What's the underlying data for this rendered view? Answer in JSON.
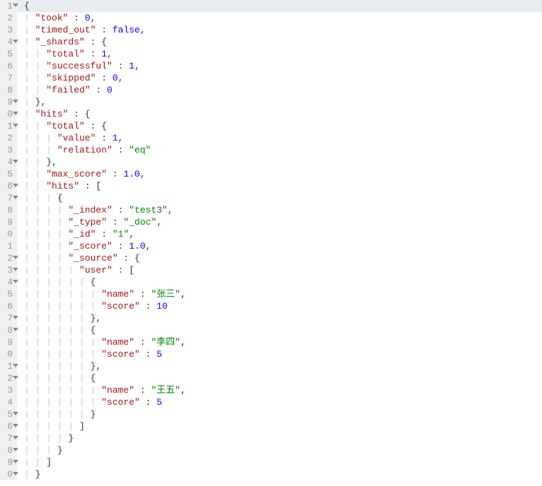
{
  "lines": [
    {
      "num": "1",
      "fold": true,
      "hl": true,
      "indent": 0,
      "text": [
        {
          "t": "pun",
          "v": "{"
        }
      ]
    },
    {
      "num": "2",
      "fold": false,
      "hl": false,
      "indent": 1,
      "text": [
        {
          "t": "key",
          "v": "\"took\""
        },
        {
          "t": "pun",
          "v": " : "
        },
        {
          "t": "num",
          "v": "0"
        },
        {
          "t": "pun",
          "v": ","
        }
      ]
    },
    {
      "num": "3",
      "fold": false,
      "hl": false,
      "indent": 1,
      "text": [
        {
          "t": "key",
          "v": "\"timed_out\""
        },
        {
          "t": "pun",
          "v": " : "
        },
        {
          "t": "kw",
          "v": "false"
        },
        {
          "t": "pun",
          "v": ","
        }
      ]
    },
    {
      "num": "4",
      "fold": true,
      "hl": false,
      "indent": 1,
      "text": [
        {
          "t": "key",
          "v": "\"_shards\""
        },
        {
          "t": "pun",
          "v": " : {"
        }
      ]
    },
    {
      "num": "5",
      "fold": false,
      "hl": false,
      "indent": 2,
      "text": [
        {
          "t": "key",
          "v": "\"total\""
        },
        {
          "t": "pun",
          "v": " : "
        },
        {
          "t": "num",
          "v": "1"
        },
        {
          "t": "pun",
          "v": ","
        }
      ]
    },
    {
      "num": "6",
      "fold": false,
      "hl": false,
      "indent": 2,
      "text": [
        {
          "t": "key",
          "v": "\"successful\""
        },
        {
          "t": "pun",
          "v": " : "
        },
        {
          "t": "num",
          "v": "1"
        },
        {
          "t": "pun",
          "v": ","
        }
      ]
    },
    {
      "num": "7",
      "fold": false,
      "hl": false,
      "indent": 2,
      "text": [
        {
          "t": "key",
          "v": "\"skipped\""
        },
        {
          "t": "pun",
          "v": " : "
        },
        {
          "t": "num",
          "v": "0"
        },
        {
          "t": "pun",
          "v": ","
        }
      ]
    },
    {
      "num": "8",
      "fold": false,
      "hl": false,
      "indent": 2,
      "text": [
        {
          "t": "key",
          "v": "\"failed\""
        },
        {
          "t": "pun",
          "v": " : "
        },
        {
          "t": "num",
          "v": "0"
        }
      ]
    },
    {
      "num": "9",
      "fold": true,
      "hl": false,
      "indent": 1,
      "text": [
        {
          "t": "pun",
          "v": "},"
        }
      ]
    },
    {
      "num": "0",
      "fold": true,
      "hl": false,
      "indent": 1,
      "text": [
        {
          "t": "key",
          "v": "\"hits\""
        },
        {
          "t": "pun",
          "v": " : {"
        }
      ]
    },
    {
      "num": "1",
      "fold": true,
      "hl": false,
      "indent": 2,
      "text": [
        {
          "t": "key",
          "v": "\"total\""
        },
        {
          "t": "pun",
          "v": " : {"
        }
      ]
    },
    {
      "num": "2",
      "fold": false,
      "hl": false,
      "indent": 3,
      "text": [
        {
          "t": "key",
          "v": "\"value\""
        },
        {
          "t": "pun",
          "v": " : "
        },
        {
          "t": "num",
          "v": "1"
        },
        {
          "t": "pun",
          "v": ","
        }
      ]
    },
    {
      "num": "3",
      "fold": false,
      "hl": false,
      "indent": 3,
      "text": [
        {
          "t": "key",
          "v": "\"relation\""
        },
        {
          "t": "pun",
          "v": " : "
        },
        {
          "t": "str",
          "v": "\"eq\""
        }
      ]
    },
    {
      "num": "4",
      "fold": true,
      "hl": false,
      "indent": 2,
      "text": [
        {
          "t": "pun",
          "v": "},"
        }
      ]
    },
    {
      "num": "5",
      "fold": false,
      "hl": false,
      "indent": 2,
      "text": [
        {
          "t": "key",
          "v": "\"max_score\""
        },
        {
          "t": "pun",
          "v": " : "
        },
        {
          "t": "num",
          "v": "1.0"
        },
        {
          "t": "pun",
          "v": ","
        }
      ]
    },
    {
      "num": "6",
      "fold": true,
      "hl": false,
      "indent": 2,
      "text": [
        {
          "t": "key",
          "v": "\"hits\""
        },
        {
          "t": "pun",
          "v": " : ["
        }
      ]
    },
    {
      "num": "7",
      "fold": true,
      "hl": false,
      "indent": 3,
      "text": [
        {
          "t": "pun",
          "v": "{"
        }
      ]
    },
    {
      "num": "8",
      "fold": false,
      "hl": false,
      "indent": 4,
      "text": [
        {
          "t": "key",
          "v": "\"_index\""
        },
        {
          "t": "pun",
          "v": " : "
        },
        {
          "t": "str",
          "v": "\"test3\""
        },
        {
          "t": "pun",
          "v": ","
        }
      ]
    },
    {
      "num": "9",
      "fold": false,
      "hl": false,
      "indent": 4,
      "text": [
        {
          "t": "key",
          "v": "\"_type\""
        },
        {
          "t": "pun",
          "v": " : "
        },
        {
          "t": "str",
          "v": "\"_doc\""
        },
        {
          "t": "pun",
          "v": ","
        }
      ]
    },
    {
      "num": "0",
      "fold": false,
      "hl": false,
      "indent": 4,
      "text": [
        {
          "t": "key",
          "v": "\"_id\""
        },
        {
          "t": "pun",
          "v": " : "
        },
        {
          "t": "str",
          "v": "\"1\""
        },
        {
          "t": "pun",
          "v": ","
        }
      ]
    },
    {
      "num": "1",
      "fold": false,
      "hl": false,
      "indent": 4,
      "text": [
        {
          "t": "key",
          "v": "\"_score\""
        },
        {
          "t": "pun",
          "v": " : "
        },
        {
          "t": "num",
          "v": "1.0"
        },
        {
          "t": "pun",
          "v": ","
        }
      ]
    },
    {
      "num": "2",
      "fold": true,
      "hl": false,
      "indent": 4,
      "text": [
        {
          "t": "key",
          "v": "\"_source\""
        },
        {
          "t": "pun",
          "v": " : {"
        }
      ]
    },
    {
      "num": "3",
      "fold": true,
      "hl": false,
      "indent": 5,
      "text": [
        {
          "t": "key",
          "v": "\"user\""
        },
        {
          "t": "pun",
          "v": " : ["
        }
      ]
    },
    {
      "num": "4",
      "fold": true,
      "hl": false,
      "indent": 6,
      "text": [
        {
          "t": "pun",
          "v": "{"
        }
      ]
    },
    {
      "num": "5",
      "fold": false,
      "hl": false,
      "indent": 7,
      "text": [
        {
          "t": "key",
          "v": "\"name\""
        },
        {
          "t": "pun",
          "v": " : "
        },
        {
          "t": "str",
          "v": "\"张三\""
        },
        {
          "t": "pun",
          "v": ","
        }
      ]
    },
    {
      "num": "6",
      "fold": false,
      "hl": false,
      "indent": 7,
      "text": [
        {
          "t": "key",
          "v": "\"score\""
        },
        {
          "t": "pun",
          "v": " : "
        },
        {
          "t": "num",
          "v": "10"
        }
      ]
    },
    {
      "num": "7",
      "fold": true,
      "hl": false,
      "indent": 6,
      "text": [
        {
          "t": "pun",
          "v": "},"
        }
      ]
    },
    {
      "num": "8",
      "fold": true,
      "hl": false,
      "indent": 6,
      "text": [
        {
          "t": "pun",
          "v": "{"
        }
      ]
    },
    {
      "num": "9",
      "fold": false,
      "hl": false,
      "indent": 7,
      "text": [
        {
          "t": "key",
          "v": "\"name\""
        },
        {
          "t": "pun",
          "v": " : "
        },
        {
          "t": "str",
          "v": "\"李四\""
        },
        {
          "t": "pun",
          "v": ","
        }
      ]
    },
    {
      "num": "0",
      "fold": false,
      "hl": false,
      "indent": 7,
      "text": [
        {
          "t": "key",
          "v": "\"score\""
        },
        {
          "t": "pun",
          "v": " : "
        },
        {
          "t": "num",
          "v": "5"
        }
      ]
    },
    {
      "num": "1",
      "fold": true,
      "hl": false,
      "indent": 6,
      "text": [
        {
          "t": "pun",
          "v": "},"
        }
      ]
    },
    {
      "num": "2",
      "fold": true,
      "hl": false,
      "indent": 6,
      "text": [
        {
          "t": "pun",
          "v": "{"
        }
      ]
    },
    {
      "num": "3",
      "fold": false,
      "hl": false,
      "indent": 7,
      "text": [
        {
          "t": "key",
          "v": "\"name\""
        },
        {
          "t": "pun",
          "v": " : "
        },
        {
          "t": "str",
          "v": "\"王五\""
        },
        {
          "t": "pun",
          "v": ","
        }
      ]
    },
    {
      "num": "4",
      "fold": false,
      "hl": false,
      "indent": 7,
      "text": [
        {
          "t": "key",
          "v": "\"score\""
        },
        {
          "t": "pun",
          "v": " : "
        },
        {
          "t": "num",
          "v": "5"
        }
      ]
    },
    {
      "num": "5",
      "fold": true,
      "hl": false,
      "indent": 6,
      "text": [
        {
          "t": "pun",
          "v": "}"
        }
      ]
    },
    {
      "num": "6",
      "fold": true,
      "hl": false,
      "indent": 5,
      "text": [
        {
          "t": "pun",
          "v": "]"
        }
      ]
    },
    {
      "num": "7",
      "fold": true,
      "hl": false,
      "indent": 4,
      "text": [
        {
          "t": "pun",
          "v": "}"
        }
      ]
    },
    {
      "num": "8",
      "fold": true,
      "hl": false,
      "indent": 3,
      "text": [
        {
          "t": "pun",
          "v": "}"
        }
      ]
    },
    {
      "num": "9",
      "fold": true,
      "hl": false,
      "indent": 2,
      "text": [
        {
          "t": "pun",
          "v": "]"
        }
      ]
    },
    {
      "num": "0",
      "fold": true,
      "hl": false,
      "indent": 1,
      "text": [
        {
          "t": "pun",
          "v": "}"
        }
      ]
    }
  ]
}
